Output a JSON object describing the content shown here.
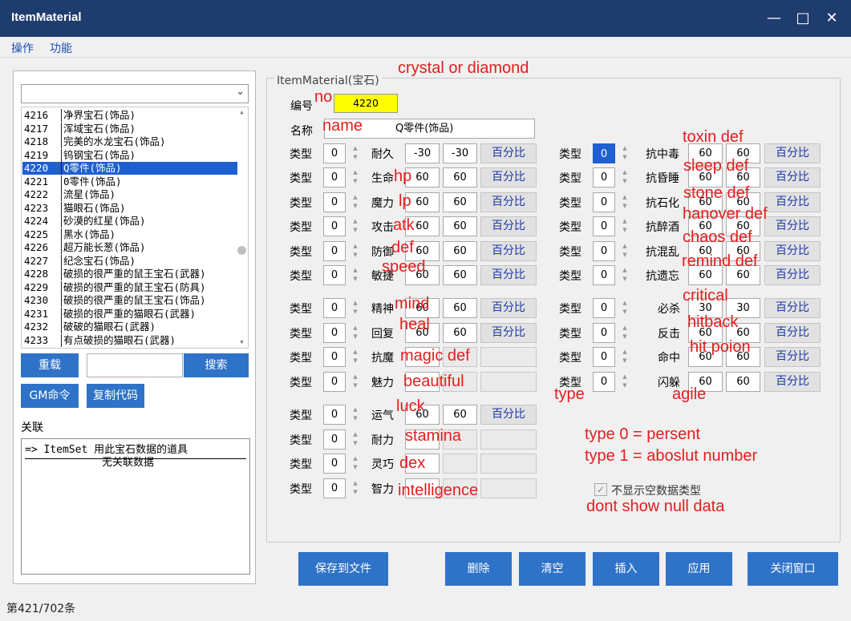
{
  "window": {
    "title": "ItemMaterial"
  },
  "menu": [
    "操作",
    "功能"
  ],
  "list": {
    "items": [
      {
        "id": "4216",
        "name": "净界宝石(饰品)"
      },
      {
        "id": "4217",
        "name": "浑域宝石(饰品)"
      },
      {
        "id": "4218",
        "name": "完美的水龙宝石(饰品)"
      },
      {
        "id": "4219",
        "name": "钨钢宝石(饰品)"
      },
      {
        "id": "4220",
        "name": "Q零件(饰品)",
        "selected": true
      },
      {
        "id": "4221",
        "name": "0零件(饰品)"
      },
      {
        "id": "4222",
        "name": "流星(饰品)"
      },
      {
        "id": "4223",
        "name": "猫眼石(饰品)"
      },
      {
        "id": "4224",
        "name": "砂漠的红星(饰品)"
      },
      {
        "id": "4225",
        "name": "黑水(饰品)"
      },
      {
        "id": "4226",
        "name": "超万能长葱(饰品)"
      },
      {
        "id": "4227",
        "name": "纪念宝石(饰品)"
      },
      {
        "id": "4228",
        "name": "破损的很严重的鼠王宝石(武器)"
      },
      {
        "id": "4229",
        "name": "破损的很严重的鼠王宝石(防具)"
      },
      {
        "id": "4230",
        "name": "破损的很严重的鼠王宝石(饰品)"
      },
      {
        "id": "4231",
        "name": "破损的很严重的猫眼石(武器)"
      },
      {
        "id": "4232",
        "name": "破破的猫眼石(武器)"
      },
      {
        "id": "4233",
        "name": "有点破损的猫眼石(武器)"
      }
    ]
  },
  "left_buttons": {
    "reload": "重载",
    "search": "搜索",
    "gm": "GM命令",
    "copy": "复制代码"
  },
  "relation": {
    "label": "关联",
    "line1": "=> ItemSet 用此宝石数据的道具",
    "line2": "无关联数据"
  },
  "group": {
    "caption": "ItemMaterial(宝石)",
    "no_label": "编号",
    "no_value": "4220",
    "name_label": "名称",
    "name_value": "Q零件(饰品)"
  },
  "labels": {
    "type": "类型",
    "pct": "百分比"
  },
  "left_rows": [
    {
      "type": "0",
      "label": "耐久",
      "v1": "-30",
      "v2": "-30",
      "pct": true
    },
    {
      "type": "0",
      "label": "生命",
      "v1": "60",
      "v2": "60",
      "pct": true
    },
    {
      "type": "0",
      "label": "魔力",
      "v1": "60",
      "v2": "60",
      "pct": true
    },
    {
      "type": "0",
      "label": "攻击",
      "v1": "60",
      "v2": "60",
      "pct": true
    },
    {
      "type": "0",
      "label": "防御",
      "v1": "60",
      "v2": "60",
      "pct": true
    },
    {
      "type": "0",
      "label": "敏捷",
      "v1": "60",
      "v2": "60",
      "pct": true
    },
    {
      "type": "0",
      "label": "精神",
      "v1": "60",
      "v2": "60",
      "pct": true
    },
    {
      "type": "0",
      "label": "回复",
      "v1": "60",
      "v2": "60",
      "pct": true
    },
    {
      "type": "0",
      "label": "抗魔",
      "v1": "",
      "v2": "",
      "pct": false
    },
    {
      "type": "0",
      "label": "魅力",
      "v1": "",
      "v2": "",
      "pct": false
    },
    {
      "type": "0",
      "label": "运气",
      "v1": "60",
      "v2": "60",
      "pct": true
    },
    {
      "type": "0",
      "label": "耐力",
      "v1": "",
      "v2": "",
      "pct": false
    },
    {
      "type": "0",
      "label": "灵巧",
      "v1": "",
      "v2": "",
      "pct": false
    },
    {
      "type": "0",
      "label": "智力",
      "v1": "",
      "v2": "",
      "pct": false
    }
  ],
  "right_rows": [
    {
      "type": "0",
      "label": "抗中毒",
      "v1": "60",
      "v2": "60",
      "focused": true
    },
    {
      "type": "0",
      "label": "抗昏睡",
      "v1": "60",
      "v2": "60"
    },
    {
      "type": "0",
      "label": "抗石化",
      "v1": "60",
      "v2": "60"
    },
    {
      "type": "0",
      "label": "抗醉酒",
      "v1": "60",
      "v2": "60"
    },
    {
      "type": "0",
      "label": "抗混乱",
      "v1": "60",
      "v2": "60"
    },
    {
      "type": "0",
      "label": "抗遗忘",
      "v1": "60",
      "v2": "60"
    },
    {
      "type": "0",
      "label": "必杀",
      "v1": "30",
      "v2": "30"
    },
    {
      "type": "0",
      "label": "反击",
      "v1": "60",
      "v2": "60"
    },
    {
      "type": "0",
      "label": "命中",
      "v1": "60",
      "v2": "60"
    },
    {
      "type": "0",
      "label": "闪躲",
      "v1": "60",
      "v2": "60"
    }
  ],
  "hide_empty_label": "不显示空数据类型",
  "actions": {
    "save": "保存到文件",
    "delete": "删除",
    "clear": "清空",
    "insert": "插入",
    "apply": "应用",
    "close": "关闭窗口"
  },
  "status": "第421/702条",
  "annotations": {
    "crystal": "crystal or diamond",
    "no": "no",
    "name": "name",
    "toxin": "toxin def",
    "sleep": "sleep def",
    "stone": "stone def",
    "hanover": "hanover def",
    "chaos": "chaos def",
    "remind": "remind def",
    "hp": "hp",
    "lp": "lp",
    "atk": "atk",
    "def": "def",
    "speed": "speed",
    "mind": "mind",
    "heal": "heal",
    "magic": "magic def",
    "beautiful": "beautiful",
    "luck": "luck",
    "stamina": "stamina",
    "dex": "dex",
    "intelligence": "intelligence",
    "critical": "critical",
    "hitback": "hitback",
    "hitpoion": "hit poion",
    "agile": "agile",
    "type": "type",
    "type0": "type 0 = persent",
    "type1": "type 1 = aboslut number",
    "dontshow": "dont show null data"
  },
  "colors": {
    "titlebar": "#1f3c6e",
    "accent": "#2f73c8",
    "selection": "#1e5fd1",
    "highlight": "#ffff00",
    "annotation": "#e51d1d"
  }
}
